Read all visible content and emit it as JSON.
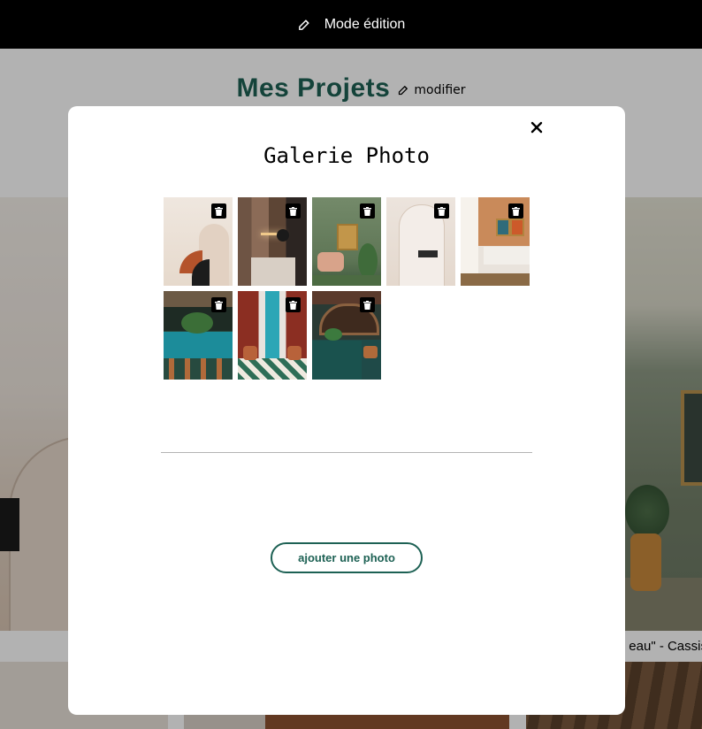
{
  "edit_bar": {
    "label": "Mode édition",
    "icon": "edit-icon"
  },
  "header": {
    "title": "Mes Projets",
    "edit_label": "modifier",
    "title_color": "#1d6154"
  },
  "background": {
    "caption_right": "eau\" - Cassis"
  },
  "modal": {
    "title": "Galerie Photo",
    "close_label": "×",
    "photos": [
      {
        "name": "photo-1",
        "delete_icon": "trash-icon"
      },
      {
        "name": "photo-2",
        "delete_icon": "trash-icon"
      },
      {
        "name": "photo-3",
        "delete_icon": "trash-icon"
      },
      {
        "name": "photo-4",
        "delete_icon": "trash-icon"
      },
      {
        "name": "photo-5",
        "delete_icon": "trash-icon"
      },
      {
        "name": "photo-6",
        "delete_icon": "trash-icon"
      },
      {
        "name": "photo-7",
        "delete_icon": "trash-icon"
      },
      {
        "name": "photo-8",
        "delete_icon": "trash-icon"
      }
    ],
    "add_button_label": "ajouter une photo",
    "accent": "#1d6154"
  }
}
